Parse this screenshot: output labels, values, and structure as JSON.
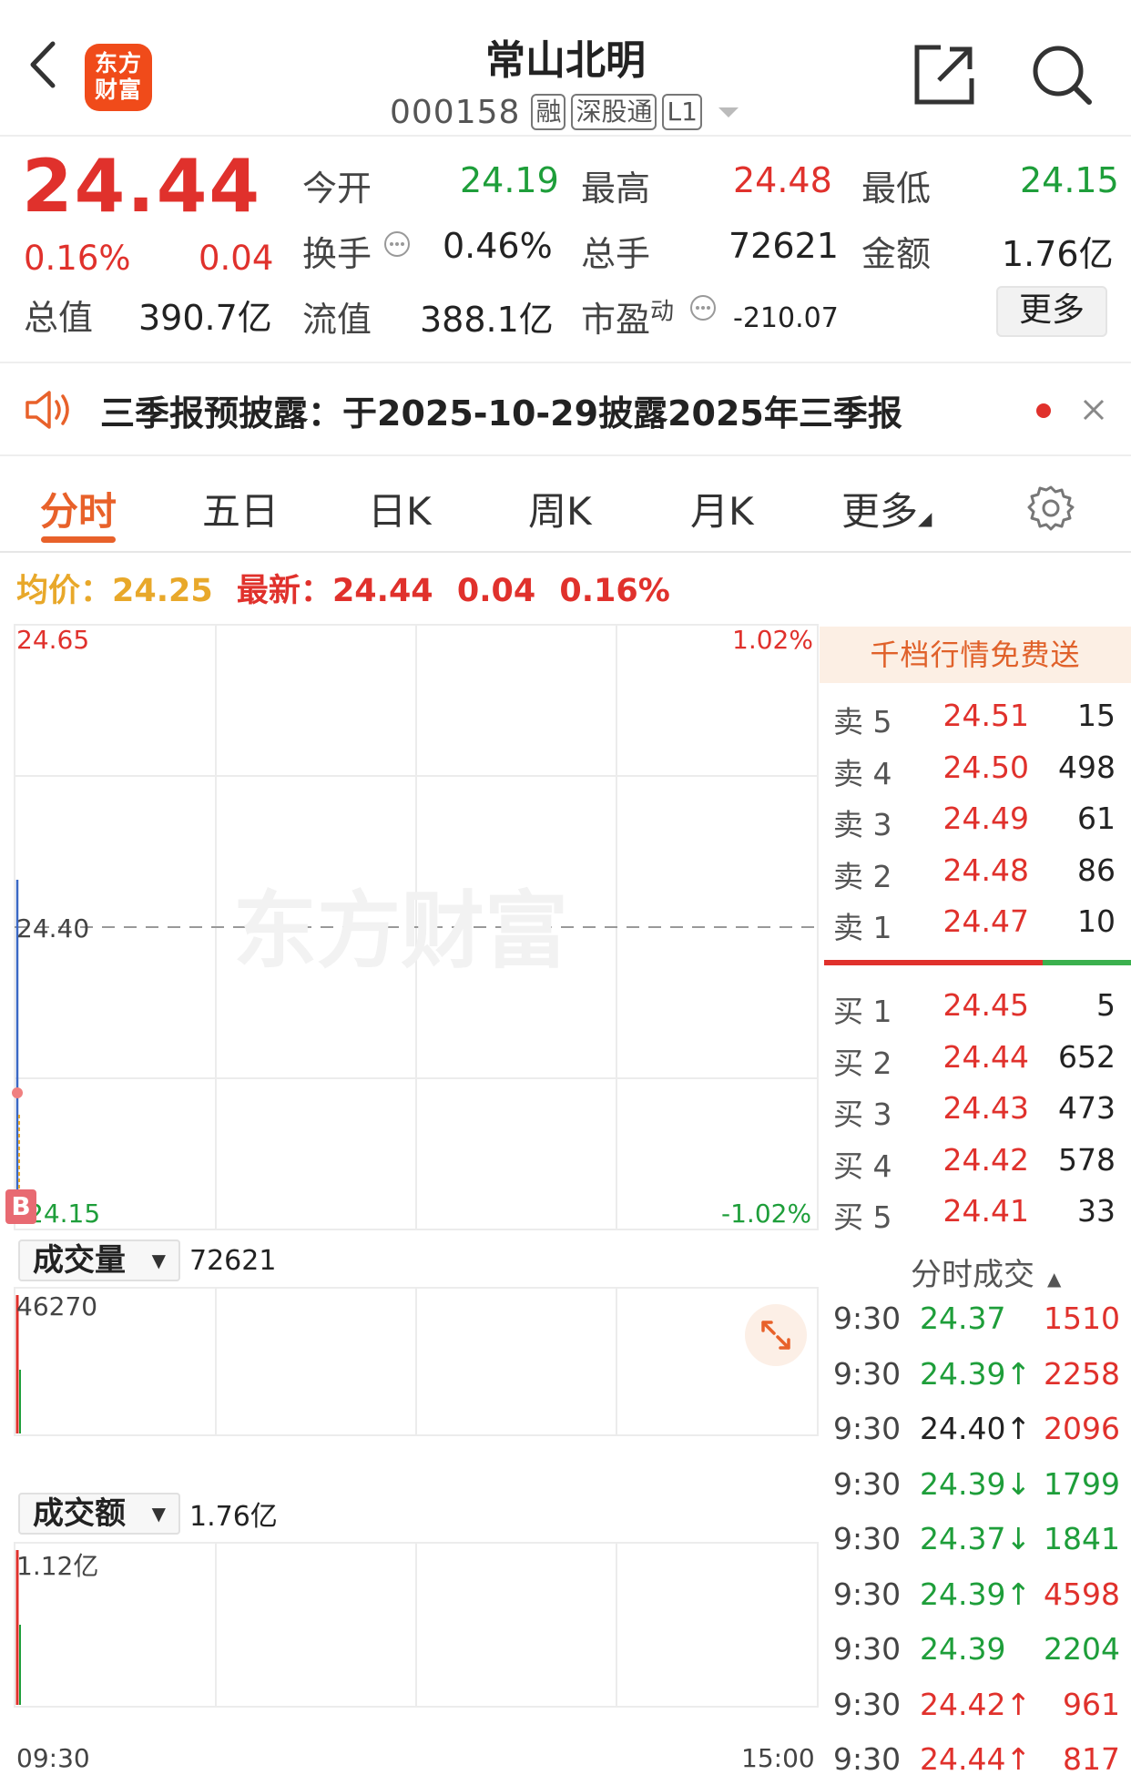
{
  "header": {
    "back_icon": "chevron-left-icon",
    "logo_text_line1": "东方",
    "logo_text_line2": "财富",
    "stock_name": "常山北明",
    "stock_code": "000158",
    "tags": [
      "融",
      "深股通",
      "L1"
    ],
    "share_icon": "external-share-icon",
    "search_icon": "search-icon"
  },
  "quote": {
    "price": "24.44",
    "change_pct": "0.16%",
    "change": "0.04",
    "total_value_label": "总值",
    "total_value": "390.7亿",
    "open_label": "今开",
    "open": "24.19",
    "high_label": "最高",
    "high": "24.48",
    "low_label": "最低",
    "low": "24.15",
    "turnover_label": "换手",
    "turnover": "0.46%",
    "volume_label": "总手",
    "volume": "72621",
    "amount_label": "金额",
    "amount": "1.76亿",
    "float_value_label": "流值",
    "float_value": "388.1亿",
    "pe_label": "市盈",
    "pe_sup": "动",
    "pe": "-210.07",
    "more_button": "更多"
  },
  "notice": {
    "text": "三季报预披露：于2025-10-29披露2025年三季报",
    "speaker_icon": "speaker-icon",
    "close_icon": "close-icon"
  },
  "tabs": {
    "items": [
      "分时",
      "五日",
      "日K",
      "周K",
      "月K",
      "更多"
    ],
    "active": "分时",
    "settings_icon": "gear-icon"
  },
  "info_line": {
    "avg_label": "均价：",
    "avg": "24.25",
    "latest_label": "最新：",
    "latest": "24.44",
    "change": "0.04",
    "change_pct": "0.16%"
  },
  "chart": {
    "y_max": "24.65",
    "y_mid": "24.40",
    "y_min": "24.15",
    "pct_max": "1.02%",
    "pct_min": "-1.02%",
    "watermark": "东方财富",
    "b_marker": "B",
    "time_start": "09:30",
    "time_end": "15:00"
  },
  "volume_panel": {
    "selector": "成交量",
    "total": "72621",
    "max_label": "46270",
    "expand_icon": "expand-arrows-icon"
  },
  "amount_panel": {
    "selector": "成交额",
    "total": "1.76亿",
    "max_label": "1.12亿"
  },
  "orderbook": {
    "banner": "千档行情免费送",
    "asks": [
      {
        "label": "卖 5",
        "price": "24.51",
        "vol": "15"
      },
      {
        "label": "卖 4",
        "price": "24.50",
        "vol": "498"
      },
      {
        "label": "卖 3",
        "price": "24.49",
        "vol": "61"
      },
      {
        "label": "卖 2",
        "price": "24.48",
        "vol": "86"
      },
      {
        "label": "卖 1",
        "price": "24.47",
        "vol": "10"
      }
    ],
    "bids": [
      {
        "label": "买 1",
        "price": "24.45",
        "vol": "5"
      },
      {
        "label": "买 2",
        "price": "24.44",
        "vol": "652"
      },
      {
        "label": "买 3",
        "price": "24.43",
        "vol": "473"
      },
      {
        "label": "买 4",
        "price": "24.42",
        "vol": "578"
      },
      {
        "label": "买 5",
        "price": "24.41",
        "vol": "33"
      }
    ]
  },
  "trades": {
    "title": "分时成交",
    "rows": [
      {
        "time": "9:30",
        "price": "24.37",
        "vol": "1510",
        "dir": "",
        "price_color": "green",
        "vol_color": "red"
      },
      {
        "time": "9:30",
        "price": "24.39↑",
        "vol": "2258",
        "dir": "up",
        "price_color": "green",
        "vol_color": "red"
      },
      {
        "time": "9:30",
        "price": "24.40↑",
        "vol": "2096",
        "dir": "up",
        "price_color": "dark",
        "vol_color": "red"
      },
      {
        "time": "9:30",
        "price": "24.39↓",
        "vol": "1799",
        "dir": "down",
        "price_color": "green",
        "vol_color": "green"
      },
      {
        "time": "9:30",
        "price": "24.37↓",
        "vol": "1841",
        "dir": "down",
        "price_color": "green",
        "vol_color": "green"
      },
      {
        "time": "9:30",
        "price": "24.39↑",
        "vol": "4598",
        "dir": "up",
        "price_color": "green",
        "vol_color": "red"
      },
      {
        "time": "9:30",
        "price": "24.39",
        "vol": "2204",
        "dir": "",
        "price_color": "green",
        "vol_color": "green"
      },
      {
        "time": "9:30",
        "price": "24.42↑",
        "vol": "961",
        "dir": "up",
        "price_color": "red",
        "vol_color": "red"
      },
      {
        "time": "9:30",
        "price": "24.44↑",
        "vol": "817",
        "dir": "up",
        "price_color": "red",
        "vol_color": "red"
      }
    ]
  },
  "colors": {
    "up": "#e0312c",
    "down": "#1e9e3a",
    "accent": "#e8612a",
    "avg_line": "#e8a82a"
  }
}
